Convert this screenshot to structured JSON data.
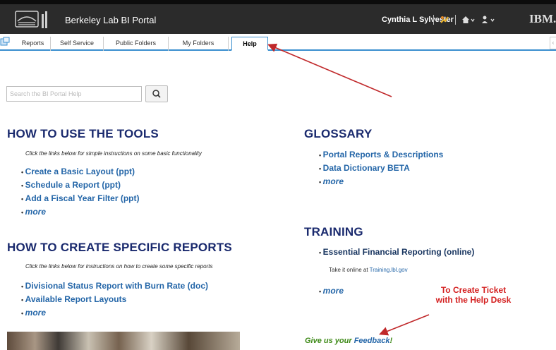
{
  "header": {
    "app_title": "Berkeley Lab BI Portal",
    "user_name": "Cynthia L Sylvester",
    "brand": "IBM."
  },
  "tabs": [
    {
      "label": "Reports"
    },
    {
      "label": "Self Service"
    },
    {
      "label": "Public Folders"
    },
    {
      "label": "My Folders"
    },
    {
      "label": "Help",
      "active": true
    }
  ],
  "search": {
    "placeholder": "Search the BI Portal Help"
  },
  "how_to_use": {
    "title": "HOW TO USE THE TOOLS",
    "intro": "Click the links below for simple instructions on some basic functionality",
    "links": [
      "Create a Basic Layout (ppt)",
      "Schedule a Report (ppt)",
      "Add a Fiscal Year Filter (ppt)"
    ],
    "more": "more"
  },
  "how_to_create": {
    "title": "HOW TO CREATE SPECIFIC REPORTS",
    "intro": "Click the links below for instructions on how to create some specific reports",
    "links": [
      "Divisional Status Report with Burn Rate (doc)",
      "Available Report Layouts"
    ],
    "more": "more"
  },
  "glossary": {
    "title": "GLOSSARY",
    "links": [
      "Portal Reports & Descriptions",
      "Data Dictionary BETA"
    ],
    "more": "more"
  },
  "training": {
    "title": "TRAINING",
    "links": [
      "Essential Financial Reporting (online)"
    ],
    "note_prefix": "Take it online at",
    "note_link": "Training.lbl.gov",
    "more": "more"
  },
  "annotation": {
    "line1": "To Create Ticket",
    "line2": "with the Help Desk",
    "color": "#d42020"
  },
  "feedback": {
    "prefix": "Give us your",
    "link": "Feedback",
    "suffix": "!"
  },
  "colors": {
    "heading": "#1a2a6e",
    "link": "#2466a8",
    "tab_accent": "#3a8fcf",
    "header_bg": "#2b2b2b"
  }
}
